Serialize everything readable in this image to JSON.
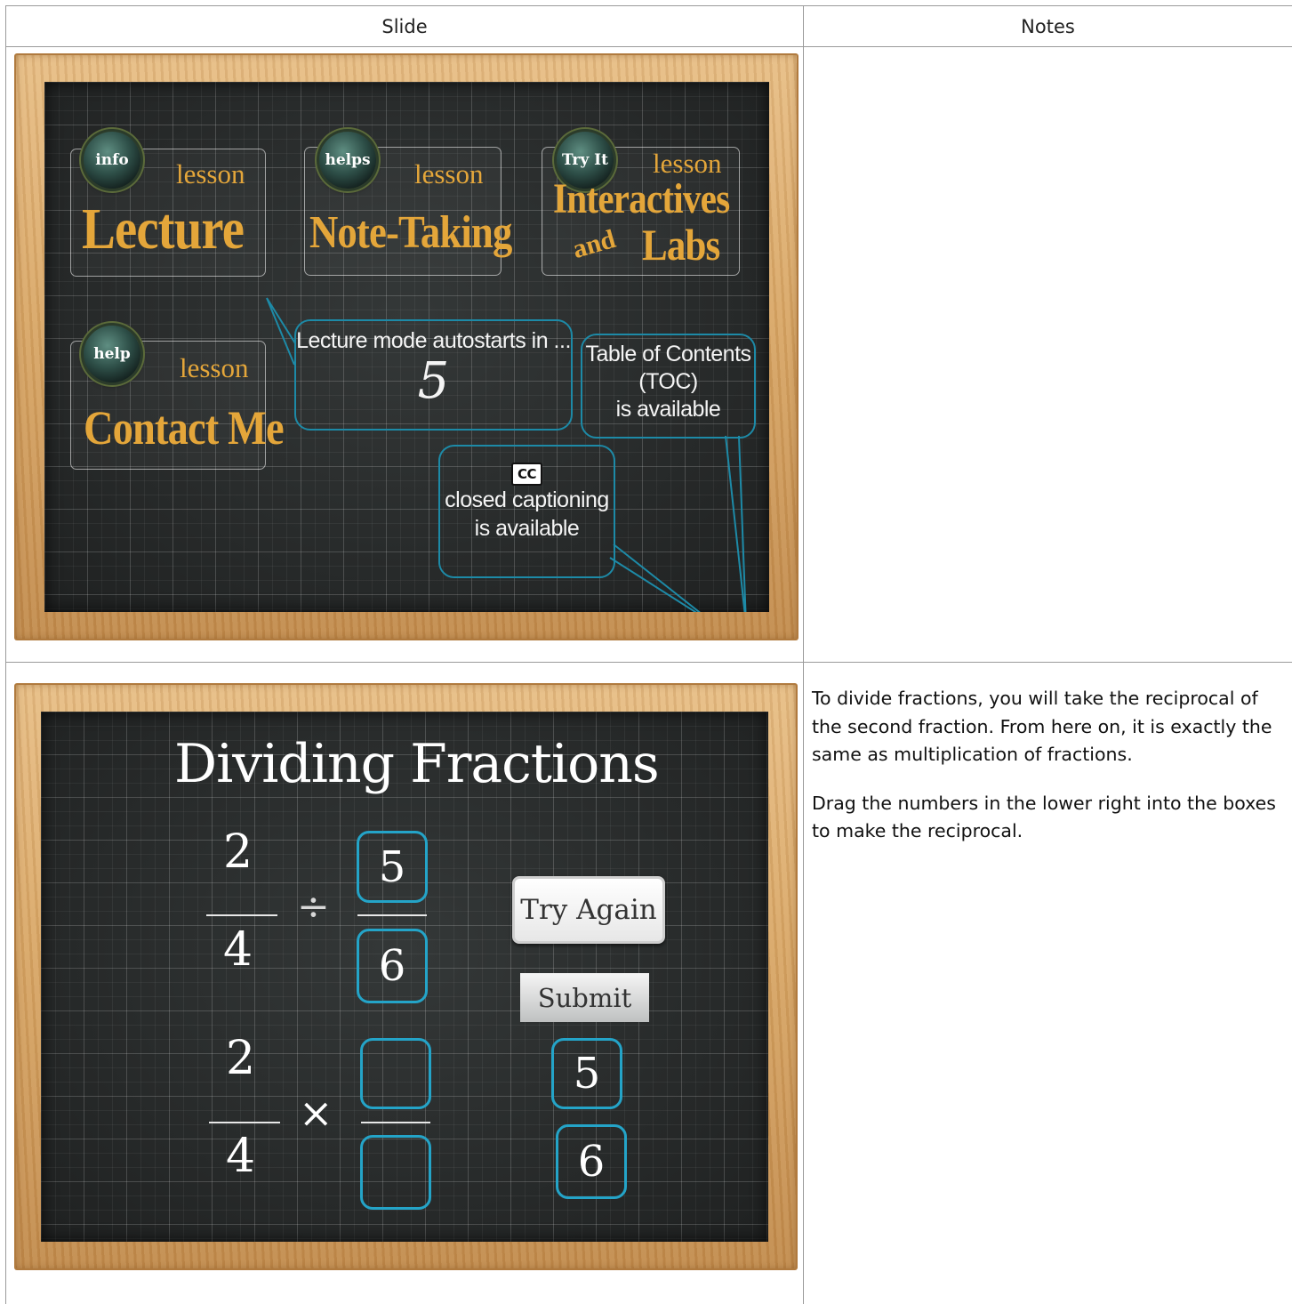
{
  "table": {
    "header": {
      "slide": "Slide",
      "notes": "Notes"
    }
  },
  "slide1": {
    "tiles": [
      {
        "badge": "info",
        "small": "lesson",
        "big": "Lecture"
      },
      {
        "badge": "helps",
        "small": "lesson",
        "big": "Note-Taking"
      },
      {
        "badge": "Try It",
        "small": "lesson",
        "big_line1": "Interactives",
        "and": "and",
        "big_line2": "Labs"
      },
      {
        "badge": "help",
        "small": "lesson",
        "big": "Contact Me"
      }
    ],
    "autostart": {
      "text": "Lecture mode autostarts in ...",
      "count": "5"
    },
    "toc": {
      "line1": "Table of Contents",
      "line2": "(TOC)",
      "line3": "is available"
    },
    "cc": {
      "badge": "CC",
      "line1": "closed captioning",
      "line2": "is available"
    },
    "notes": ""
  },
  "slide2": {
    "title": "Dividing Fractions",
    "row1": {
      "num": "2",
      "den": "4",
      "op": "÷",
      "box_num": "5",
      "box_den": "6"
    },
    "row2": {
      "num": "2",
      "den": "4",
      "op": "×",
      "box_num": "",
      "box_den": ""
    },
    "try_again": "Try Again",
    "submit": "Submit",
    "tiles": [
      "5",
      "6"
    ],
    "notes": [
      "To divide fractions, you will take the reciprocal of the second fraction. From here on, it is exactly the same as multiplication of fractions.",
      "Drag the numbers in the lower right into the boxes to make the reciprocal."
    ]
  }
}
